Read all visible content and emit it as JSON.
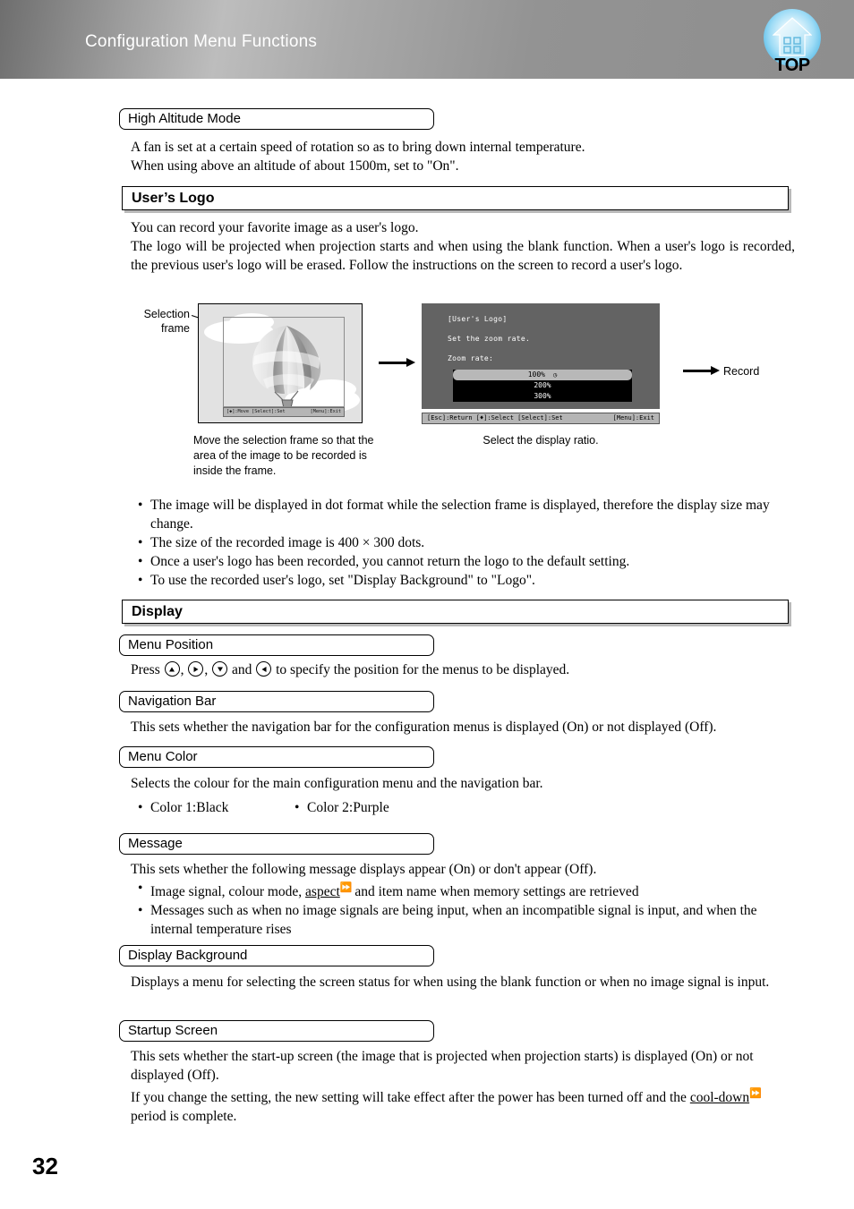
{
  "header": {
    "title": "Configuration Menu Functions",
    "badge_label": "TOP",
    "badge_icon": "home-icon"
  },
  "sections": [
    {
      "id": "high-altitude-mode",
      "kind": "subhead",
      "heading": "High Altitude Mode",
      "paragraphs": [
        "A fan is set at a certain speed of rotation so as to bring down internal temperature.",
        "When using above an altitude of about 1500m, set to \"On\"."
      ]
    },
    {
      "id": "users-logo",
      "kind": "section",
      "heading": "User’s Logo",
      "paragraphs": [
        "You can record your favorite image as a user's logo.",
        "The logo will be projected when projection starts and when using the blank function. When a user's logo is recorded, the previous user's logo will be erased. Follow the instructions on the screen to record a user's logo."
      ],
      "bullets": [
        "The image will be displayed in dot format while the selection frame is displayed, therefore the display size may change.",
        "The size of the recorded image is 400 × 300 dots.",
        "Once a user's logo has been recorded, you cannot return the logo to the default setting.",
        "To use the recorded user's logo, set \"Display Background\" to \"Logo\"."
      ]
    },
    {
      "id": "display",
      "kind": "section",
      "heading": "Display"
    },
    {
      "id": "menu-position",
      "kind": "subhead",
      "heading": "Menu Position",
      "press_prefix": "Press",
      "press_suffix": "to specify the position for the menus to be displayed.",
      "separator_comma": ",",
      "separator_and": "and",
      "keys": [
        "up-arrow-key",
        "right-arrow-key",
        "down-arrow-key",
        "left-arrow-key"
      ]
    },
    {
      "id": "navigation-bar",
      "kind": "subhead",
      "heading": "Navigation Bar",
      "paragraphs": [
        "This sets whether the navigation bar for the configuration menus is displayed (On) or not displayed (Off)."
      ]
    },
    {
      "id": "menu-color",
      "kind": "subhead",
      "heading": "Menu Color",
      "paragraphs": [
        "Selects the colour for the main configuration menu and the navigation bar."
      ],
      "color_options": [
        "Color 1:Black",
        "Color 2:Purple"
      ]
    },
    {
      "id": "message",
      "kind": "subhead",
      "heading": "Message",
      "paragraphs": [
        "This sets whether the following message displays appear (On) or don't appear (Off)."
      ],
      "bullet_1_before": "Image signal, colour mode, ",
      "bullet_1_link": "aspect",
      "bullet_1_after": " and item name when memory settings are retrieved",
      "bullet_2": "Messages such as when no image signals are being input, when an incompatible signal is input, and when the internal temperature rises"
    },
    {
      "id": "display-background",
      "kind": "subhead",
      "heading": "Display Background",
      "paragraphs": [
        "Displays a menu for selecting the screen status for when using the blank function or when no image signal is input."
      ]
    },
    {
      "id": "startup-screen",
      "kind": "subhead",
      "heading": "Startup Screen",
      "paragraphs": [
        "This sets whether the start-up screen (the image that is projected when projection starts) is displayed (On) or not displayed (Off)."
      ],
      "last_before": "If you change the setting, the new setting will take effect after the power has been turned off and the ",
      "last_link": "cool-down",
      "last_after": " period is complete."
    }
  ],
  "figure": {
    "selection_frame_label_line1": "Selection",
    "selection_frame_label_line2": "frame",
    "left_caption": "Move the selection frame so that the area of the image to be recorded is inside the frame.",
    "right_caption": "Select the display ratio.",
    "record_label": "Record",
    "balloon_screenshot": {
      "navbar_left": "[◆]:Move [Select]:Set",
      "navbar_right": "[Menu]:Exit"
    },
    "menu_screenshot": {
      "title": "[User's Logo]",
      "instruction": "Set the zoom rate.",
      "field_label": "Zoom rate:",
      "options": [
        "100%",
        "200%",
        "300%"
      ],
      "selected_option": "100%",
      "navbar_left": "[Esc]:Return [♦]:Select [Select]:Set",
      "navbar_right": "[Menu]:Exit"
    }
  },
  "footer": {
    "page_number": "32"
  }
}
